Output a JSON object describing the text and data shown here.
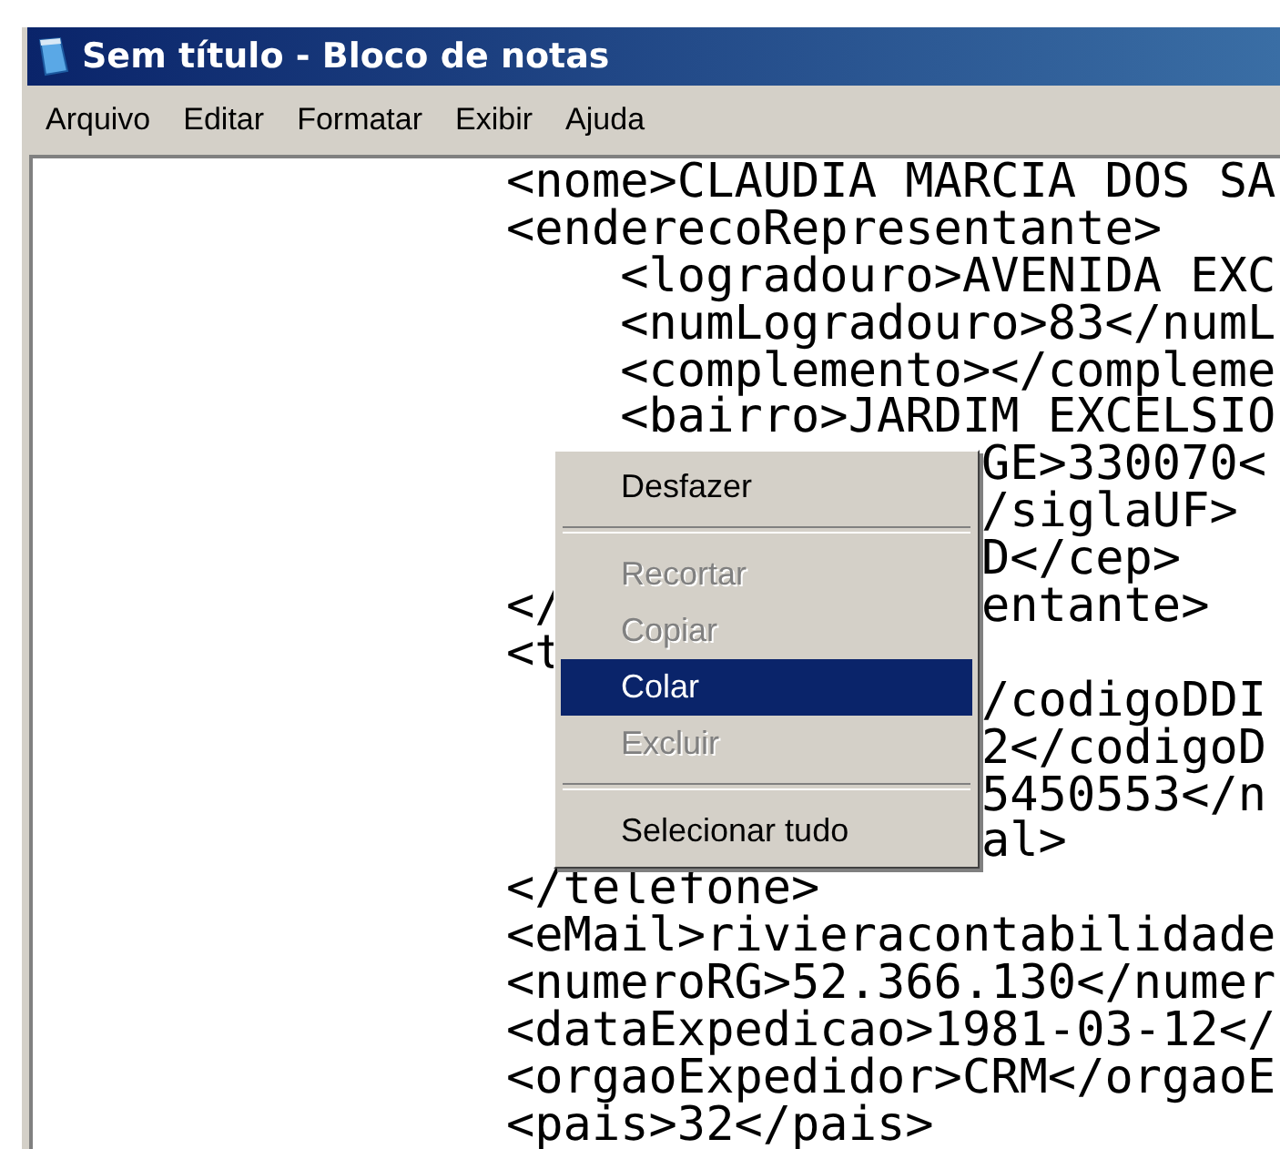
{
  "window": {
    "title": "Sem título - Bloco de notas"
  },
  "menu_bar": [
    "Arquivo",
    "Editar",
    "Formatar",
    "Exibir",
    "Ajuda"
  ],
  "editor": {
    "lines": [
      {
        "text": "<nome>CLAUDIA MARCIA DOS SA"
      },
      {
        "text": "<enderecoRepresentante>",
        "children": [
          {
            "text": "<logradouro>AVENIDA EXC"
          },
          {
            "text": "<numLogradouro>83</numL"
          },
          {
            "text": "<complemento></compleme"
          },
          {
            "text": "<bairro>JARDIM EXCELSIO"
          },
          {
            "right": "GE>330070<"
          },
          {
            "right": "/siglaUF>"
          },
          {
            "right": "D</cep>"
          }
        ]
      },
      {
        "text": "</",
        "right": "entante>"
      },
      {
        "text": "<t",
        "children": [
          {
            "right": "/codigoDDI"
          },
          {
            "right": "2</codigoD"
          },
          {
            "right": "5450553</n"
          },
          {
            "right": "al>"
          }
        ]
      },
      {
        "text": "</telefone>"
      },
      {
        "text": "<eMail>rivieracontabilidade"
      },
      {
        "text": "<numeroRG>52.366.130</numer"
      },
      {
        "text": "<dataExpedicao>1981-03-12</"
      },
      {
        "text": "<orgaoExpedidor>CRM</orgaoE"
      },
      {
        "text": "<pais>32</pais>"
      }
    ]
  },
  "context_menu": [
    {
      "kind": "item",
      "label": "Desfazer",
      "disabled": false,
      "selected": false
    },
    {
      "kind": "separator"
    },
    {
      "kind": "item",
      "label": "Recortar",
      "disabled": true,
      "selected": false
    },
    {
      "kind": "item",
      "label": "Copiar",
      "disabled": true,
      "selected": false
    },
    {
      "kind": "item",
      "label": "Colar",
      "disabled": false,
      "selected": true
    },
    {
      "kind": "item",
      "label": "Excluir",
      "disabled": true,
      "selected": false
    },
    {
      "kind": "separator"
    },
    {
      "kind": "item",
      "label": "Selecionar tudo",
      "disabled": false,
      "selected": false
    }
  ]
}
